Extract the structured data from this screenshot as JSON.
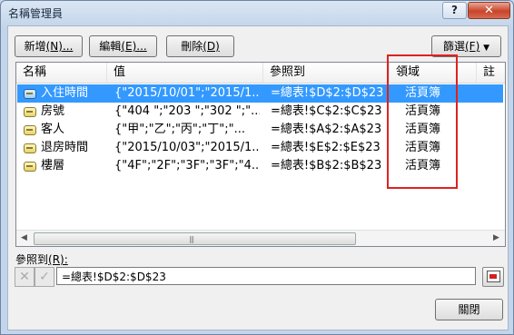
{
  "window": {
    "title": "名稱管理員",
    "help_label": "?",
    "close_label": "✕"
  },
  "toolbar": {
    "new_label": "新增",
    "new_key": "(N)...",
    "edit_label": "編輯",
    "edit_key": "(E)...",
    "delete_label": "刪除",
    "delete_key": "(D)",
    "filter_label": "篩選",
    "filter_key": "(F)",
    "filter_arrow": "▼"
  },
  "list": {
    "columns": [
      "名稱",
      "值",
      "參照到",
      "領域",
      "註解"
    ],
    "rows": [
      {
        "name": "入住時間",
        "value": "{\"2015/10/01\";\"2015/1...",
        "ref": "=總表!$D$2:$D$23",
        "scope": "活頁簿",
        "comment": "",
        "selected": true
      },
      {
        "name": "房號",
        "value": "{\"404 \";\"203 \";\"302 \";\"...",
        "ref": "=總表!$C$2:$C$23",
        "scope": "活頁簿",
        "comment": "",
        "selected": false
      },
      {
        "name": "客人",
        "value": "{\"甲\";\"乙\";\"丙\";\"丁\";\"...",
        "ref": "=總表!$A$2:$A$23",
        "scope": "活頁簿",
        "comment": "",
        "selected": false
      },
      {
        "name": "退房時間",
        "value": "{\"2015/10/03\";\"2015/1...",
        "ref": "=總表!$E$2:$E$23",
        "scope": "活頁簿",
        "comment": "",
        "selected": false
      },
      {
        "name": "樓層",
        "value": "{\"4F\";\"2F\";\"3F\";\"3F\";\"4...",
        "ref": "=總表!$B$2:$B$23",
        "scope": "活頁簿",
        "comment": "",
        "selected": false
      }
    ],
    "scroll_left": "◀",
    "scroll_right": "▶",
    "grip": "|||"
  },
  "refers_to": {
    "label": "參照到",
    "key": "(R):",
    "cancel_icon": "✕",
    "confirm_icon": "✓",
    "value": "=總表!$D$2:$D$23"
  },
  "footer": {
    "close_label": "關閉"
  },
  "colors": {
    "selection": "#3399ff",
    "highlight_box": "#e02020"
  }
}
